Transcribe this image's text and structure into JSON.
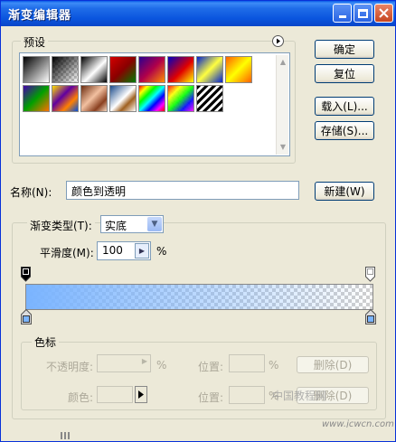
{
  "window": {
    "title": "渐变编辑器"
  },
  "presets": {
    "label": "预设",
    "swatches": [
      {
        "name": "foreground-to-background"
      },
      {
        "name": "foreground-to-transparent"
      },
      {
        "name": "black-white"
      },
      {
        "name": "red-green"
      },
      {
        "name": "violet-orange"
      },
      {
        "name": "blue-red-yellow"
      },
      {
        "name": "blue-yellow-blue"
      },
      {
        "name": "orange-yellow-orange"
      },
      {
        "name": "violet-green-orange"
      },
      {
        "name": "yellow-violet-orange-blue"
      },
      {
        "name": "copper"
      },
      {
        "name": "chrome"
      },
      {
        "name": "spectrum"
      },
      {
        "name": "transparent-rainbow"
      },
      {
        "name": "transparent-stripes"
      }
    ]
  },
  "buttons": {
    "ok": "确定",
    "reset": "复位",
    "load": "载入(L)...",
    "save": "存储(S)...",
    "new": "新建(W)"
  },
  "name_field": {
    "label": "名称(N):",
    "value": "颜色到透明"
  },
  "gradient": {
    "type_label": "渐变类型(T):",
    "type_value": "实底",
    "smoothness_label": "平滑度(M):",
    "smoothness_value": "100",
    "smoothness_unit": "%"
  },
  "stops": {
    "label": "色标",
    "opacity_label": "不透明度:",
    "opacity_unit": "%",
    "location_label_1": "位置:",
    "location_unit_1": "%",
    "delete_label_1": "删除(D)",
    "color_label": "颜色:",
    "location_label_2": "位置:",
    "location_unit_2": "%",
    "delete_label_2": "删除(D)"
  },
  "watermark": {
    "text": "中国教程网",
    "url": "www.jcwcn.com"
  },
  "colors": {
    "gradient_start": "#7ab4ff",
    "title_bar": "#0a55de"
  }
}
